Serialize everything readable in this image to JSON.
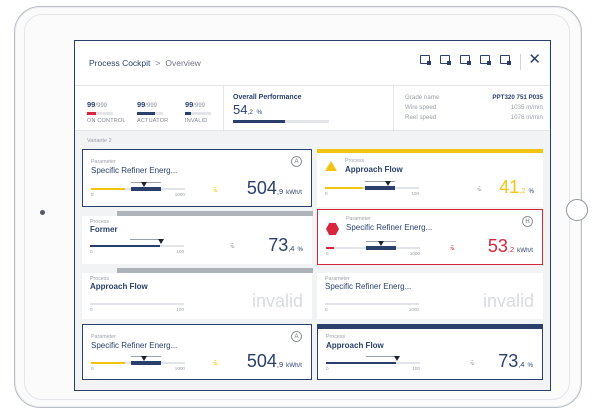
{
  "header": {
    "breadcrumb_root": "Process Cockpit",
    "breadcrumb_separator": ">",
    "breadcrumb_current": "Overview",
    "close_glyph": "✕"
  },
  "status": {
    "items": [
      {
        "value": "99",
        "max": "/999",
        "label": "ON CONTROL",
        "color": "#d7263d"
      },
      {
        "value": "99",
        "max": "/999",
        "label": "ACTUATOR",
        "color": "#2a3f6c"
      },
      {
        "value": "99",
        "max": "/999",
        "label": "INVALID",
        "color": "#2a3f6c"
      }
    ],
    "overall_title": "Overall Performance",
    "overall_value": "54",
    "overall_decimal": ",2",
    "overall_unit": "%",
    "overall_fraction": 0.54
  },
  "grade": {
    "grade_label": "Grade name",
    "grade_value": "PPT320 751 P035",
    "wire_label": "Wire speed",
    "wire_value": "1035 m/min",
    "reel_label": "Reel speed",
    "reel_value": "1076 m/min"
  },
  "variant_label": "Variante 2",
  "tiles": {
    "t1": {
      "kind": "Parameter",
      "name": "Specific Refiner Energ...",
      "badge": "A",
      "lo": "0",
      "hi": "1000",
      "value": "504",
      "decimal": ",9",
      "unit": "kWh/t",
      "trend": "⩯"
    },
    "t2": {
      "kind": "Process",
      "name": "Approach Flow",
      "lo": "0",
      "hi": "100",
      "value": "41",
      "decimal": ",2",
      "unit": "%",
      "trend": "⩯"
    },
    "t3": {
      "kind": "Process",
      "name": "Former",
      "lo": "0",
      "hi": "100",
      "value": "73",
      "decimal": ",4",
      "unit": "%",
      "trend": "⩯"
    },
    "t4": {
      "kind": "Parameter",
      "name": "Specific Refiner Energ...",
      "badge": "H",
      "lo": "0",
      "hi": "1000",
      "value": "53",
      "decimal": ",2",
      "unit": "kWh/t",
      "trend": "⩯"
    },
    "t5": {
      "kind": "Process",
      "name": "Approach Flow",
      "lo": "0",
      "hi": "100",
      "invalid": "invalid"
    },
    "t6": {
      "kind": "Parameter",
      "name": "Specific Refiner Energ...",
      "lo": "0",
      "hi": "1000",
      "invalid": "invalid"
    },
    "t7": {
      "kind": "Parameter",
      "name": "Specific Refiner Energ...",
      "badge": "A",
      "lo": "0",
      "hi": "1000",
      "value": "504",
      "decimal": ",9",
      "unit": "kWh/t",
      "trend": "⩯"
    },
    "t8": {
      "kind": "Process",
      "name": "Approach Flow",
      "lo": "0",
      "hi": "100",
      "value": "73",
      "decimal": ",4",
      "unit": "%",
      "trend": "⩯"
    }
  },
  "colors": {
    "navy": "#2a3f6c",
    "warning": "#f1c40f",
    "alarm": "#d7263d",
    "muted": "#aeb3b9"
  },
  "icons": [
    "window-icon",
    "close-icon",
    "warning-triangle-icon",
    "alarm-hexagon-icon",
    "trend-arrows-icon"
  ]
}
